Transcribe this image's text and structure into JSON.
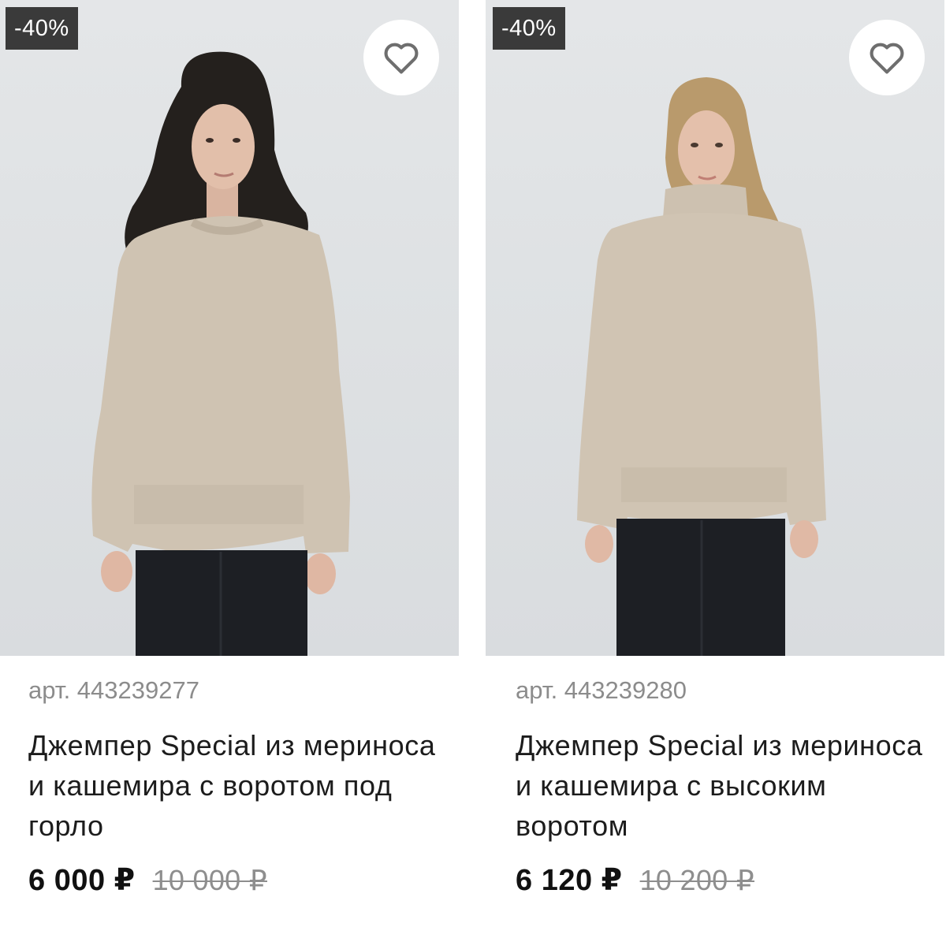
{
  "products": [
    {
      "discount_badge": "-40%",
      "favorite_icon": "heart-outline-icon",
      "sku": "арт. 443239277",
      "title": "Джемпер Special из мериноса и кашемира с воротом под горло",
      "price_current": "6 000 ₽",
      "price_old": "10 000 ₽",
      "photo_alt": "Модель в бежевом джемпере с круглым вырезом"
    },
    {
      "discount_badge": "-40%",
      "favorite_icon": "heart-outline-icon",
      "sku": "арт. 443239280",
      "title": "Джемпер Special из мериноса и кашемира с высоким воротом",
      "price_current": "6 120 ₽",
      "price_old": "10 200 ₽",
      "photo_alt": "Модель в бежевом свитере с высоким воротом"
    }
  ],
  "colors": {
    "badge_bg": "#3a3a3a",
    "sweater": "#cfc3b2",
    "trousers": "#1d1f24",
    "backdrop": "#dfe2e4"
  }
}
